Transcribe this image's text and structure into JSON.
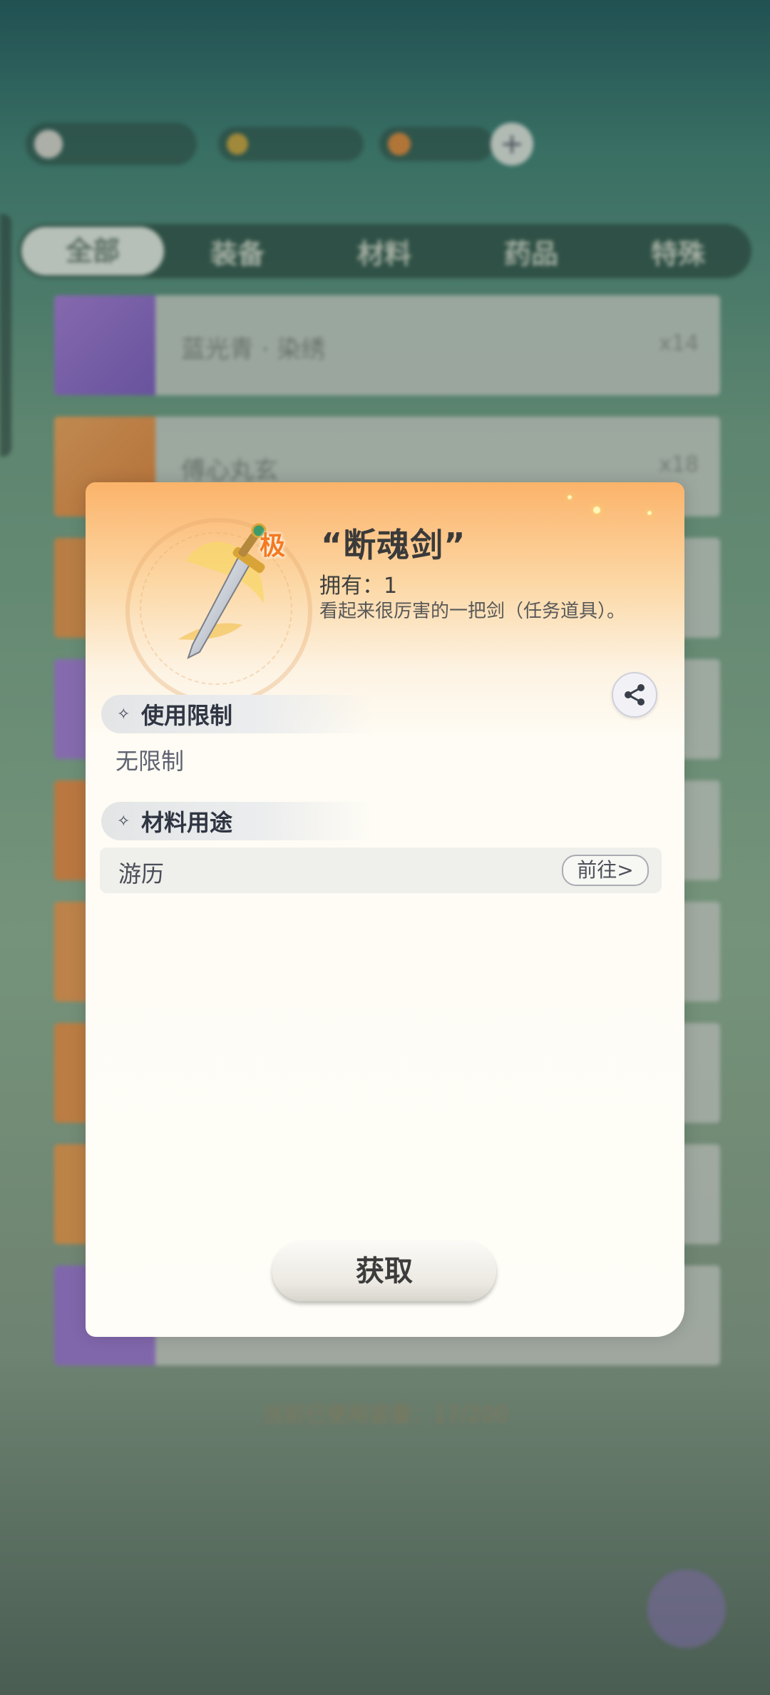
{
  "background": {
    "tabs": [
      "全部",
      "装备",
      "材料",
      "药品",
      "特殊"
    ],
    "list_items": [
      {
        "name": "蓝光青 · 染绣",
        "qty": "x14"
      },
      {
        "name": "傅心丸玄",
        "qty": "x18"
      }
    ],
    "footer_note": "当前已使用容量：17/200"
  },
  "modal": {
    "item_title": "“断魂剑”",
    "grade_badge": "极",
    "own_label": "拥有：",
    "own_count": "1",
    "description": "看起来很厉害的一把剑（任务道具）。",
    "share_icon": "share-icon",
    "usage_limit": {
      "heading": "使用限制",
      "value": "无限制"
    },
    "material_use": {
      "heading": "材料用途",
      "rows": [
        {
          "label": "游历",
          "goto_label": "前往>"
        }
      ]
    },
    "acquire_label": "获取"
  },
  "colors": {
    "grade": "#f57a20",
    "modal_top": "#fbb36a"
  }
}
